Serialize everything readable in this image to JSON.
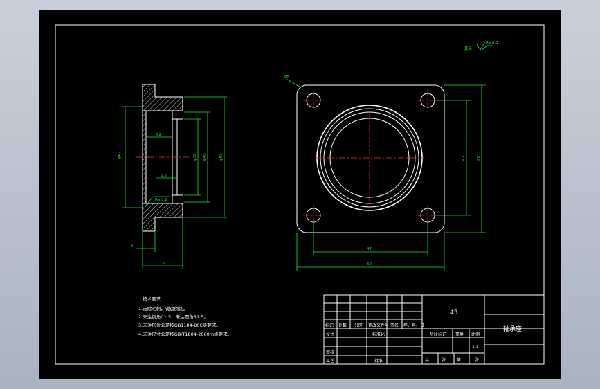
{
  "drawing": {
    "roughness_mark": "其余",
    "roughness_value": "Ra 6.3",
    "section_roughness": "Ra 3.2",
    "corner_radius_label": "R5",
    "dims": {
      "bore_dia": "φ42",
      "inner_h1": "φ38",
      "inner_h2": "φ40",
      "outer_h": "φ50",
      "depth_62": "62",
      "chamfer": "2.5",
      "flange_t": "5",
      "total_w": "18",
      "hole_spacing_h": "47",
      "hole_spacing_v": "47",
      "overall_w": "60",
      "overall_h": "60"
    }
  },
  "tech_req": {
    "title": "技术要求",
    "lines": [
      "1.去除毛刺，锐边倒钝。",
      "2.未注倒角C1.5，未注圆角R1.5。",
      "3.未注形位公差按GB1184-80C级要求。",
      "4.未注尺寸公差按GB/T1804-2000m级要求。"
    ]
  },
  "title_block": {
    "material": "45",
    "part_name": "轴承座",
    "scale": "1:1",
    "row_labels": [
      "标记",
      "处数",
      "分区",
      "更改文件号",
      "签名",
      "年、月、日"
    ],
    "design": "设计",
    "standardize": "标准化",
    "review": "审核",
    "process": "工艺",
    "approve": "批准",
    "stage_mark": "阶段标记",
    "weight": "重量",
    "ratio": "比例",
    "sheets_total": "共",
    "sheets": "张",
    "sheet_no": "第",
    "sheet_no2": "张"
  }
}
